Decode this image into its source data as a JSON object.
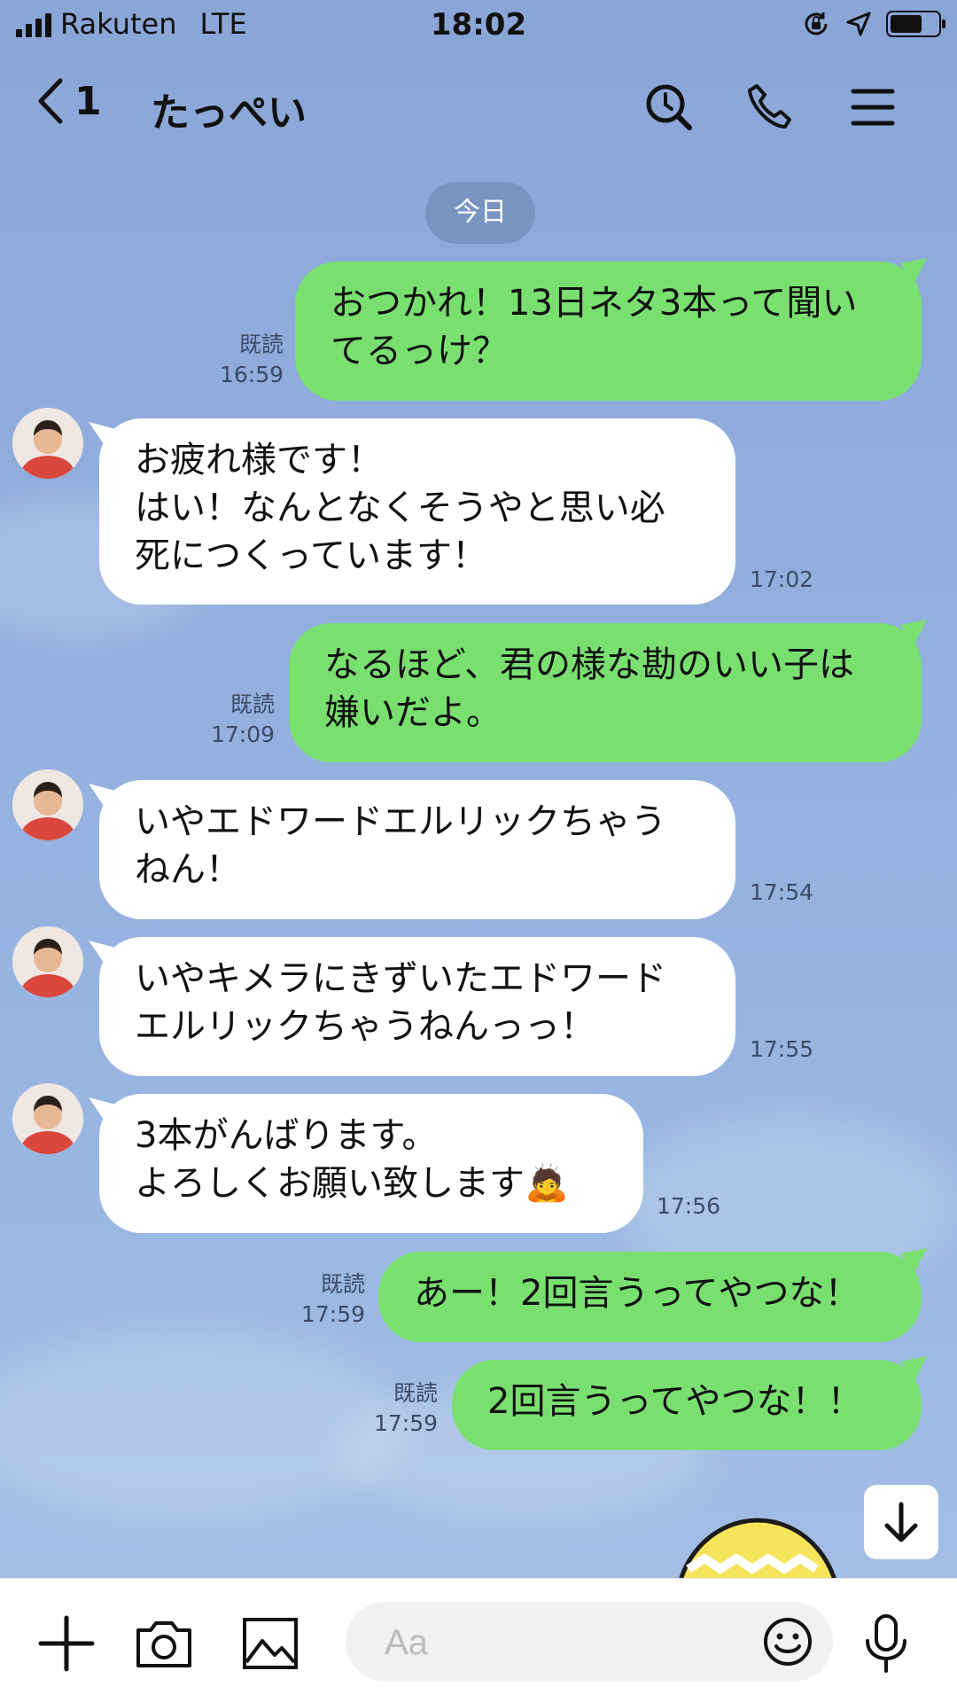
{
  "status_bar": {
    "carrier": "Rakuten",
    "network": "LTE",
    "time": "18:02"
  },
  "header": {
    "back_count": "1",
    "title": "たっぺい"
  },
  "date_divider": "今日",
  "messages": [
    {
      "side": "out",
      "text": "おつかれ！13日ネタ3本って聞い\nてるっけ？",
      "read": "既読",
      "time": "16:59"
    },
    {
      "side": "in",
      "text": "お疲れ様です！\nはい！なんとなくそうやと思い必\n死につくっています！",
      "time": "17:02"
    },
    {
      "side": "out",
      "text": "なるほど、君の様な勘のいい子は\n嫌いだよ。",
      "read": "既読",
      "time": "17:09"
    },
    {
      "side": "in",
      "text": "いやエドワードエルリックちゃう\nねん！",
      "time": "17:54"
    },
    {
      "side": "in",
      "text": "いやキメラにきずいたエドワード\nエルリックちゃうねんっっ！",
      "time": "17:55"
    },
    {
      "side": "in",
      "text": "3本がんばります。\nよろしくお願い致します🙇",
      "time": "17:56"
    },
    {
      "side": "out",
      "text": "あー！2回言うってやつな！",
      "read": "既読",
      "time": "17:59"
    },
    {
      "side": "out",
      "text": "2回言うってやつな！！",
      "read": "既読",
      "time": "17:59"
    }
  ],
  "input": {
    "placeholder": "Aa"
  },
  "icons": {
    "back": "chevron-left-icon",
    "search": "search-icon",
    "call": "phone-icon",
    "menu": "menu-icon",
    "plus": "plus-icon",
    "camera": "camera-icon",
    "image": "image-icon",
    "emoji": "emoji-icon",
    "mic": "microphone-icon",
    "scroll": "arrow-down-icon"
  },
  "colors": {
    "background": "#8ca9d8",
    "outgoing_bubble": "#79e070",
    "incoming_bubble": "#ffffff",
    "date_pill": "#7894c0"
  }
}
